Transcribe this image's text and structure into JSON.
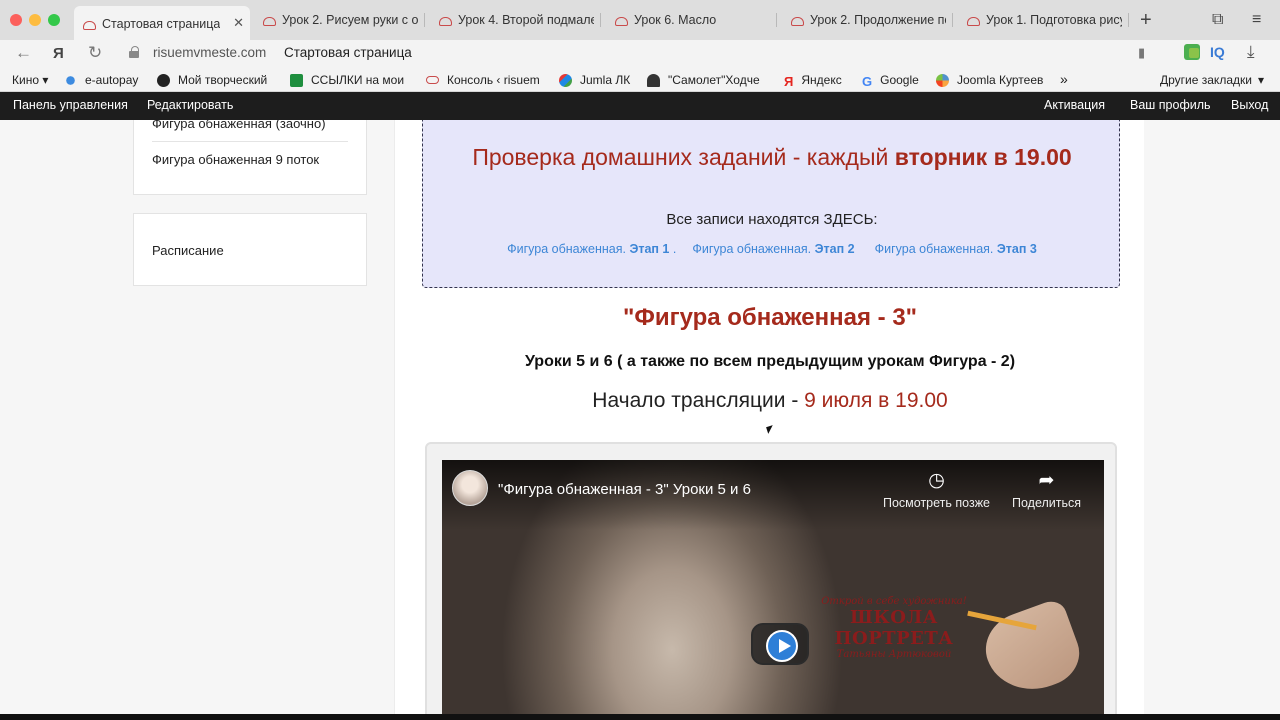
{
  "browser": {
    "tabs": [
      {
        "title": "Стартовая страница",
        "active": true
      },
      {
        "title": "Урок 2. Рисуем руки с о"
      },
      {
        "title": "Урок 4. Второй подмале"
      },
      {
        "title": "Урок 6. Масло"
      },
      {
        "title": "Урок 2. Продолжение по"
      },
      {
        "title": "Урок 1. Подготовка рису"
      }
    ],
    "ya_label": "Я",
    "iq_label": "IQ",
    "url_domain": "risuemvmeste.com",
    "url_title": "Стартовая страница",
    "bookmarks": [
      {
        "label": "Кино ▾"
      },
      {
        "label": "e-autopay"
      },
      {
        "label": "Мой творческий"
      },
      {
        "label": "ССЫЛКИ на мои"
      },
      {
        "label": "Консоль ‹ risuem"
      },
      {
        "label": "Jumla ЛК"
      },
      {
        "label": "\"Самолет\"Ходче"
      },
      {
        "label": "Яндекс"
      },
      {
        "label": "Google"
      },
      {
        "label": "Joomla Куртеев"
      }
    ],
    "bookmarks_more": "»",
    "other_bookmarks": "Другие закладки"
  },
  "adminbar": {
    "dashboard": "Панель управления",
    "edit": "Редактировать",
    "activation": "Активация",
    "profile": "Ваш профиль",
    "logout": "Выход"
  },
  "sidebar": {
    "box1_items": [
      "Фигура обнаженная (заочно)",
      "Фигура обнаженная 9 поток"
    ],
    "box2_items": [
      "Расписание"
    ]
  },
  "homework": {
    "title_normal": "Проверка домашних заданий - каждый ",
    "title_bold": "вторник в 19.00",
    "subtitle": "Все записи находятся ЗДЕСЬ:",
    "links": [
      {
        "prefix": "Фигура обнаженная. ",
        "bold": "Этап 1",
        "suffix": " ."
      },
      {
        "prefix": "Фигура обнаженная. ",
        "bold": "Этап 2",
        "suffix": ""
      },
      {
        "prefix": "Фигура обнаженная. ",
        "bold": "Этап 3",
        "suffix": ""
      }
    ]
  },
  "course": {
    "heading": "\"Фигура обнаженная - 3\"",
    "lessons": "Уроки 5 и 6  ( а также по всем предыдущим урокам Фигура -  2)",
    "stream_prefix": "Начало трансляции - ",
    "stream_highlight": "9 июля  в 19.00"
  },
  "video": {
    "title": "\"Фигура обнаженная - 3\" Уроки 5 и 6",
    "watch_later": "Посмотреть позже",
    "share": "Поделиться",
    "school_top": "Открой в себе художника!",
    "school_name": "ШКОЛА ПОРТРЕТА",
    "school_author": "Татьяны Артюковой"
  },
  "colors": {
    "accent_red": "#a52a1c",
    "link_blue": "#3d86d6",
    "admin_bar": "#1d1d1d",
    "homework_bg": "#e6e6fa"
  }
}
